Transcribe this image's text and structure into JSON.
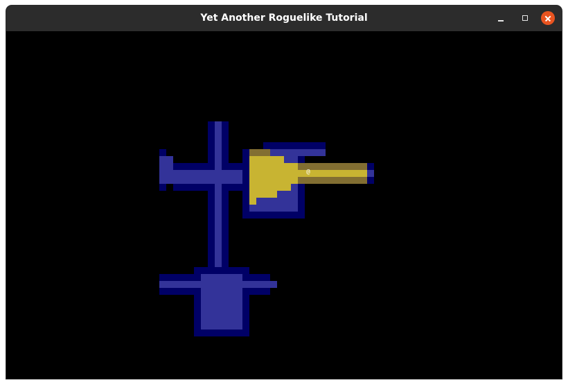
{
  "window": {
    "title": "Yet Another Roguelike Tutorial"
  },
  "icons": {
    "minimize": "minimize-icon",
    "maximize": "maximize-icon",
    "close": "close-icon"
  },
  "game": {
    "player_glyph": "@",
    "colors": {
      "background": "#000000",
      "light_wall": "#333399",
      "dark_wall": "#000066",
      "lit_floor": "#c8b432",
      "dim_floor": "#826e32",
      "player": "#ffffff"
    }
  }
}
